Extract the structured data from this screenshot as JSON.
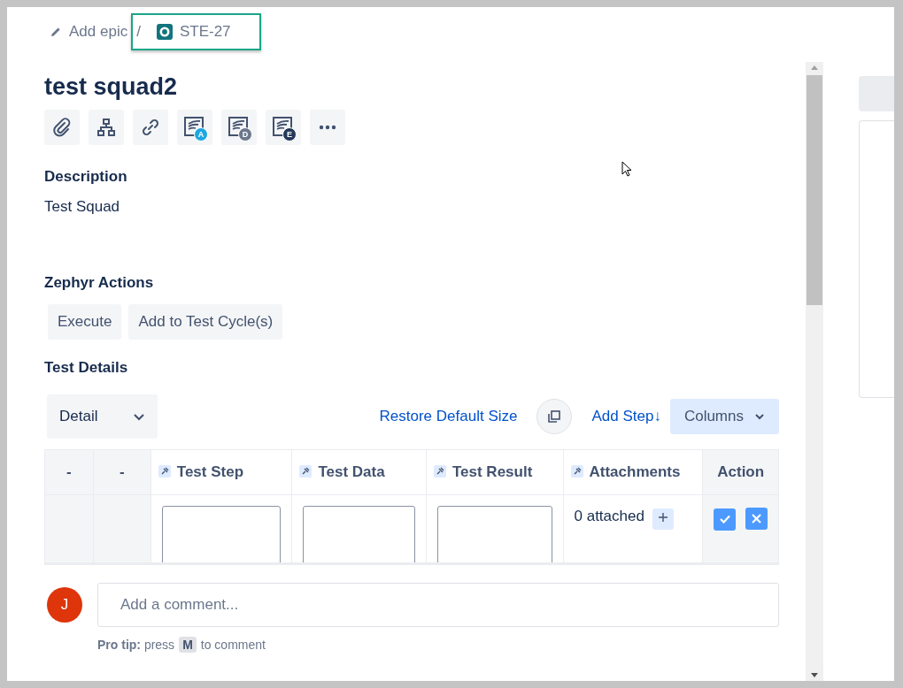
{
  "breadcrumb": {
    "add_epic": "Add epic",
    "separator": "/",
    "issue_key": "STE-27"
  },
  "issue": {
    "title": "test squad2"
  },
  "toolbar": [
    {
      "kind": "attachment"
    },
    {
      "kind": "hierarchy"
    },
    {
      "kind": "link"
    },
    {
      "kind": "sheet",
      "badge": "A",
      "color": "#1ea7e1"
    },
    {
      "kind": "sheet",
      "badge": "D",
      "color": "#6b778c"
    },
    {
      "kind": "sheet",
      "badge": "E",
      "color": "#253858"
    },
    {
      "kind": "more"
    }
  ],
  "description": {
    "heading": "Description",
    "text": "Test Squad"
  },
  "zephyr_actions": {
    "heading": "Zephyr Actions",
    "buttons": [
      "Execute",
      "Add to Test Cycle(s)"
    ]
  },
  "test_details": {
    "heading": "Test Details",
    "view_select": "Detail",
    "restore_link": "Restore Default Size",
    "add_step_link": "Add Step↓",
    "columns_button": "Columns",
    "columns": [
      {
        "label": "-",
        "pinned": false
      },
      {
        "label": "-",
        "pinned": false
      },
      {
        "label": "Test Step",
        "pinned": true
      },
      {
        "label": "Test Data",
        "pinned": true
      },
      {
        "label": "Test Result",
        "pinned": true
      },
      {
        "label": "Attachments",
        "pinned": true
      },
      {
        "label": "Action",
        "pinned": false
      }
    ],
    "new_row": {
      "attachments": "0 attached"
    }
  },
  "comment": {
    "avatar": "J",
    "placeholder": "Add a comment...",
    "tip": "**Pro tip:** press",
    "tip_key": "M",
    "tip_end": "to comment"
  }
}
